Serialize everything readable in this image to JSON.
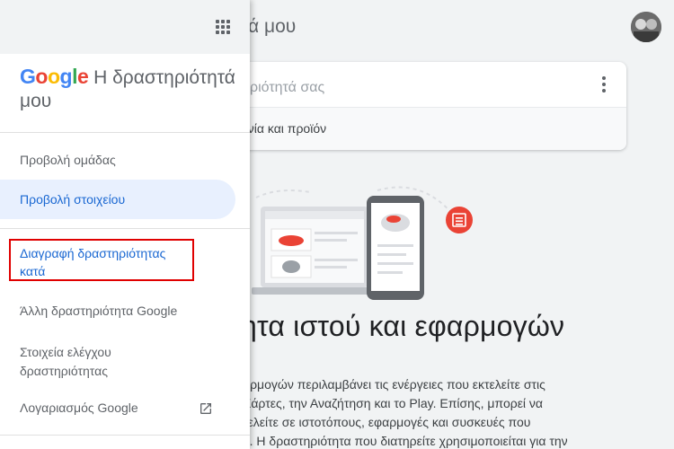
{
  "page": {
    "title_fragment": "τά μου",
    "search_placeholder": "ριότητά σας",
    "filter_label": "ηνία και προϊόν",
    "heading": "ητα ιστού και εφαρμογών",
    "body_lines": [
      "αρμογών περιλαμβάνει τις ενέργειες που εκτελείτε στις",
      "Χάρτες, την Αναζήτηση και το Play. Επίσης, μπορεί να",
      "τελείτε σε ιστοτόπους, εφαρμογές και συσκευές που",
      "υ. Η δραστηριότητα που διατηρείτε χρησιμοποιείται για την"
    ]
  },
  "drawer": {
    "logo": {
      "G": "G",
      "o1": "o",
      "o2": "o",
      "g": "g",
      "l": "l",
      "e": "e"
    },
    "title_line1": "Η δραστηριότητά",
    "title_line2": "μου",
    "items": [
      {
        "label": "Προβολή ομάδας"
      },
      {
        "label": "Προβολή στοιχείου"
      },
      {
        "label_line1": "Διαγραφή δραστηριότητας",
        "label_line2": "κατά"
      },
      {
        "label": "Άλλη δραστηριότητα Google"
      },
      {
        "label_line1": "Στοιχεία ελέγχου",
        "label_line2": "δραστηριότητας"
      },
      {
        "label": "Λογαριασμός Google"
      }
    ]
  },
  "colors": {
    "accent": "#1967d2",
    "active_bg": "#e8f0fe",
    "highlight": "#e00000",
    "page_bg": "#f1f3f4"
  },
  "icons": [
    "apps-grid-icon",
    "kebab-menu-icon",
    "open-in-new-icon",
    "notes-badge-icon"
  ]
}
